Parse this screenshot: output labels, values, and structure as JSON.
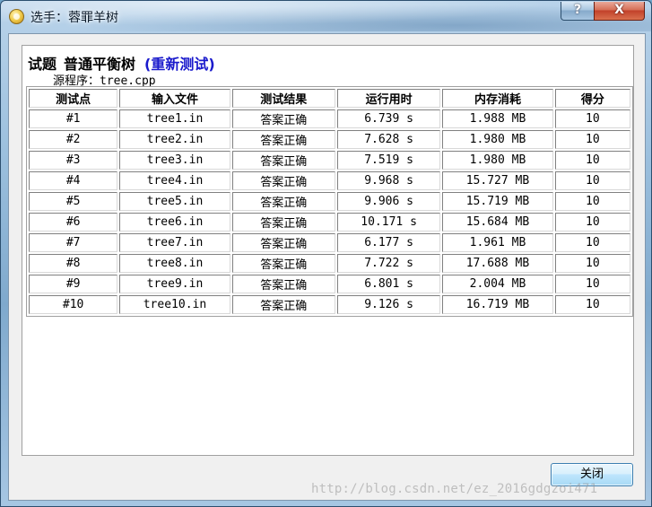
{
  "window": {
    "title": "选手：蓉罪羊树",
    "help_label": "?",
    "close_label": "X"
  },
  "report": {
    "heading_prefix": "试题",
    "problem_name": "普通平衡树",
    "retest_label": "(重新测试)",
    "source_line": "源程序：tree.cpp"
  },
  "table": {
    "headers": [
      "测试点",
      "输入文件",
      "测试结果",
      "运行用时",
      "内存消耗",
      "得分"
    ],
    "rows": [
      [
        "#1",
        "tree1.in",
        "答案正确",
        "6.739 s",
        "1.988 MB",
        "10"
      ],
      [
        "#2",
        "tree2.in",
        "答案正确",
        "7.628 s",
        "1.980 MB",
        "10"
      ],
      [
        "#3",
        "tree3.in",
        "答案正确",
        "7.519 s",
        "1.980 MB",
        "10"
      ],
      [
        "#4",
        "tree4.in",
        "答案正确",
        "9.968 s",
        "15.727 MB",
        "10"
      ],
      [
        "#5",
        "tree5.in",
        "答案正确",
        "9.906 s",
        "15.719 MB",
        "10"
      ],
      [
        "#6",
        "tree6.in",
        "答案正确",
        "10.171 s",
        "15.684 MB",
        "10"
      ],
      [
        "#7",
        "tree7.in",
        "答案正确",
        "6.177 s",
        "1.961 MB",
        "10"
      ],
      [
        "#8",
        "tree8.in",
        "答案正确",
        "7.722 s",
        "17.688 MB",
        "10"
      ],
      [
        "#9",
        "tree9.in",
        "答案正确",
        "6.801 s",
        "2.004 MB",
        "10"
      ],
      [
        "#10",
        "tree10.in",
        "答案正确",
        "9.126 s",
        "16.719 MB",
        "10"
      ]
    ]
  },
  "footer": {
    "close_button_label": "关闭",
    "watermark": "http://blog.csdn.net/ez_2016gdgzoi471"
  }
}
